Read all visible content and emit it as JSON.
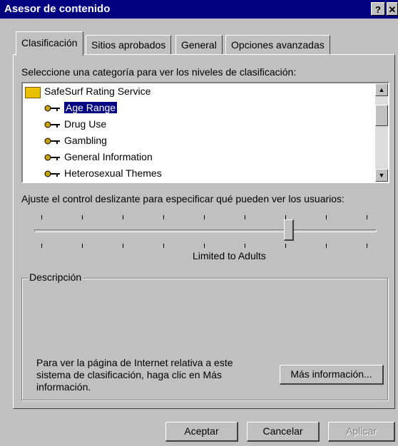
{
  "window": {
    "title": "Asesor de contenido",
    "help_glyph": "?",
    "close_glyph": "✕"
  },
  "tabs": [
    {
      "label": "Clasificación",
      "active": true
    },
    {
      "label": "Sitios aprobados",
      "active": false
    },
    {
      "label": "General",
      "active": false
    },
    {
      "label": "Opciones avanzadas",
      "active": false
    }
  ],
  "category_prompt": "Seleccione una categoría para ver los niveles de clasificación:",
  "category_list": {
    "root": "SafeSurf Rating Service",
    "items": [
      "Age Range",
      "Drug Use",
      "Gambling",
      "General Information",
      "Heterosexual Themes"
    ],
    "selected": "Age Range"
  },
  "slider_prompt": "Ajuste el control deslizante para especificar qué pueden ver los usuarios:",
  "slider": {
    "level_label": "Limited to Adults",
    "tick_count": 9,
    "position_index": 7
  },
  "description": {
    "legend": "Descripción",
    "text": "Para ver la página de Internet relativa a este sistema de clasificación, haga clic en Más información.",
    "more_button": "Más información..."
  },
  "buttons": {
    "ok": "Aceptar",
    "cancel": "Cancelar",
    "apply": "Aplicar"
  }
}
